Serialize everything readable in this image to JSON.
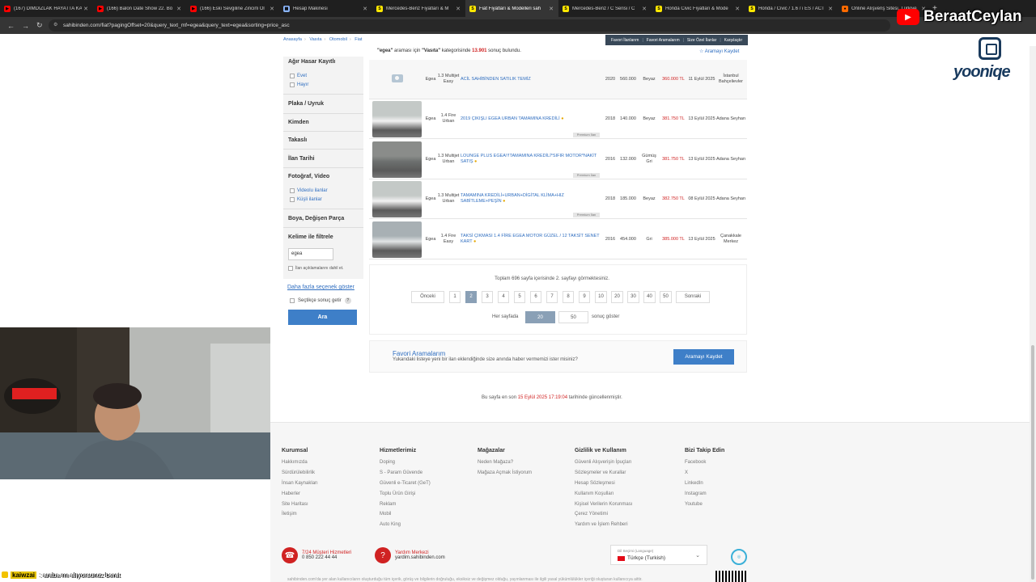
{
  "browser": {
    "tabs": [
      {
        "title": "(167) DIMDIZLAK HAYATTA KA",
        "fav": "▶",
        "color": "#ff0000",
        "active": false
      },
      {
        "title": "(166) Balon Date Show 22. Bö",
        "fav": "▶",
        "color": "#ff0000",
        "active": false
      },
      {
        "title": "(166) Eski Sevgiline Zincirli Ol",
        "fav": "▶",
        "color": "#ff0000",
        "active": false
      },
      {
        "title": "Hesap Makinesi",
        "fav": "▦",
        "color": "#8ab4f8",
        "active": false
      },
      {
        "title": "Mercedes-Benz Fiyatları & M",
        "fav": "S",
        "color": "#ffe800",
        "active": false
      },
      {
        "title": "Fiat Fiyatları & Modelleri sah",
        "fav": "S",
        "color": "#ffe800",
        "active": true
      },
      {
        "title": "Mercedes-Benz / C Serisi / C",
        "fav": "S",
        "color": "#ffe800",
        "active": false
      },
      {
        "title": "Honda Civic Fiyatları & Mode",
        "fav": "S",
        "color": "#ffe800",
        "active": false
      },
      {
        "title": "Honda / Civic / 1.6 / i ES / ACT",
        "fav": "S",
        "color": "#ffe800",
        "active": false
      },
      {
        "title": "Online Alışveriş Sitesi, Türkiye",
        "fav": "●",
        "color": "#ff6a00",
        "active": false
      }
    ],
    "url": "sahibinden.com/fiat?pagingOffset=20&query_text_mf=egea&query_text=egea&sorting=price_asc"
  },
  "overlay": {
    "channel": "BeraatCeylan",
    "logo_text": "yooniqe",
    "chat_user": "kaiwzai",
    "chat_message": ": araba mı alıyorsunuz berat"
  },
  "breadcrumb": [
    "Anasayfa",
    "Vasıta",
    "Otomobil",
    "Fiat"
  ],
  "toplinks": [
    "Favori İlanlarım",
    "Favori Aramalarım",
    "Size Özel İlanlar",
    "Karşılaştır"
  ],
  "result": {
    "query": "\"egea\"",
    "mid": " araması için ",
    "category": "\"Vasıta\"",
    "mid2": " kategorisinde ",
    "count": "13.901",
    "end": " sonuç bulundu."
  },
  "save_search_link": "Aramayı Kaydet",
  "sidebar": {
    "agir_hasar": "Ağır Hasar Kayıtlı",
    "evet": "Evet",
    "hayir": "Hayır",
    "plaka": "Plaka / Uyruk",
    "kimden": "Kimden",
    "takasli": "Takaslı",
    "ilan_tarihi": "İlan Tarihi",
    "foto_video": "Fotoğraf, Video",
    "videolu": "Videolu ilanlar",
    "kusli": "Küşli ilanlar",
    "boya": "Boya, Değişen Parça",
    "kelime": "Kelime ile filtrele",
    "keyword_value": "egea",
    "aciklama": "İlan açıklamalarını dahil et.",
    "more": "Daha fazla seçenek göster",
    "secili": "Seçtikçe sonuç getir",
    "help": "?",
    "search_btn": "Ara"
  },
  "listings": [
    {
      "model": "Egea",
      "series": "1.3 Multijet Easy",
      "title": "ACİL SAHİBİNDEN SATILIK TEMİZ",
      "year": "2020",
      "km": "560.000",
      "color": "Beyaz",
      "price": "360.000 TL",
      "date": "11 Eylül 2025",
      "loc": "İstanbul Bahçelievler",
      "premium": false,
      "photo": false
    },
    {
      "model": "Egea",
      "series": "1.4 Fire Urban",
      "title": "2019 ÇIKIŞLI EGEA URBAN TAMAMINA KREDİLİ",
      "year": "2018",
      "km": "140.000",
      "color": "Beyaz",
      "price": "381.750 TL",
      "date": "13 Eylül 2025",
      "loc": "Adana Seyhan",
      "premium": true,
      "photo": true,
      "pic": "white"
    },
    {
      "model": "Egea",
      "series": "1.3 Multijet Urban",
      "title": "LOUNGE PLUS EGEA!!!TAMAMINA KREDİLİ*SIFIR MOTOR*NAKİT SATIŞ",
      "year": "2016",
      "km": "132.000",
      "color": "Gümüş Gri",
      "price": "381.750 TL",
      "date": "13 Eylül 2025",
      "loc": "Adana Seyhan",
      "premium": true,
      "photo": true,
      "pic": "grey"
    },
    {
      "model": "Egea",
      "series": "1.3 Multijet Urban",
      "title": "TAMAMINA KREDİLİ+URBAN+DİGİTAL KLİMA+HIZ SABİTLEME+PEŞİN",
      "year": "2018",
      "km": "185.000",
      "color": "Beyaz",
      "price": "382.750 TL",
      "date": "08 Eylül 2025",
      "loc": "Adana Seyhan",
      "premium": true,
      "photo": true,
      "pic": "white"
    },
    {
      "model": "Egea",
      "series": "1.4 Fire Easy",
      "title": "TAKSİ ÇIKMASI 1.4 FİRE EGEA MOTOR GÜZEL / 12 TAKSİT SENET KART",
      "year": "2016",
      "km": "454.000",
      "color": "Gri",
      "price": "385.000 TL",
      "date": "13 Eylül 2025",
      "loc": "Çanakkale Merkez",
      "premium": false,
      "photo": true,
      "pic": "silver"
    }
  ],
  "pagination": {
    "total_text": "Toplam 696 sayfa içerisinde 2. sayfayı görmektesiniz.",
    "prev": "Önceki",
    "next": "Sonraki",
    "pages": [
      "1",
      "2",
      "3",
      "4",
      "5",
      "6",
      "7",
      "8",
      "9",
      "10",
      "20",
      "30",
      "40",
      "50"
    ],
    "current": "2",
    "per_page_label": "Her sayfada",
    "per_page_options": [
      "20",
      "50"
    ],
    "per_page_selected": "20",
    "per_page_suffix": "sonuç göster"
  },
  "fav_search": {
    "title": "Favori Aramalarım",
    "subtitle": "Yukarıdaki listeye yeni bir ilan eklendiğinde size anında haber vermemizi ister misiniz?",
    "button": "Aramayı Kaydet"
  },
  "updated": {
    "pre": "Bu sayfa en son ",
    "date": "15 Eylül 2025 17:19:04",
    "post": " tarihinde güncellenmiştir."
  },
  "footer": {
    "columns": [
      {
        "title": "Kurumsal",
        "items": [
          "Hakkımızda",
          "Sürdürülebilirlik",
          "İnsan Kaynakları",
          "Haberler",
          "Site Haritası",
          "İletişim"
        ]
      },
      {
        "title": "Hizmetlerimiz",
        "items": [
          "Doping",
          "S - Param Güvende",
          "Güvenli e-Ticaret (GeT)",
          "Toplu Ürün Girişi",
          "Reklam",
          "Mobil",
          "Auto King"
        ]
      },
      {
        "title": "Mağazalar",
        "items": [
          "Neden Mağaza?",
          "Mağaza Açmak İstiyorum"
        ]
      },
      {
        "title": "Gizlilik ve Kullanım",
        "items": [
          "Güvenli Alışverişin İpuçları",
          "Sözleşmeler ve Kurallar",
          "Hesap Sözleşmesi",
          "Kullanım Koşulları",
          "Kişisel Verilerin Korunması",
          "Çerez Yönetimi",
          "Yardım ve İşlem Rehberi"
        ]
      },
      {
        "title": "Bizi Takip Edin",
        "items": [
          "Facebook",
          "X",
          "LinkedIn",
          "Instagram",
          "Youtube"
        ]
      }
    ],
    "support_title": "7/24 Müşteri Hizmetleri",
    "support_phone": "0 850 222 44 44",
    "help_title": "Yardım Merkezi",
    "help_url": "yardim.sahibinden.com",
    "lang_label": "Dil Seçimi (Language)",
    "lang_value": "Türkçe (Turkish)",
    "disclaimer": "sahibinden.com'da yer alan kullanıcıların oluşturduğu tüm içerik, görüş ve bilgilerin doğruluğu, eksiksiz ve değişmez olduğu, yayınlanması ile ilgili yasal yükümlülükler içeriği oluşturan kullanıcıya aittir."
  }
}
